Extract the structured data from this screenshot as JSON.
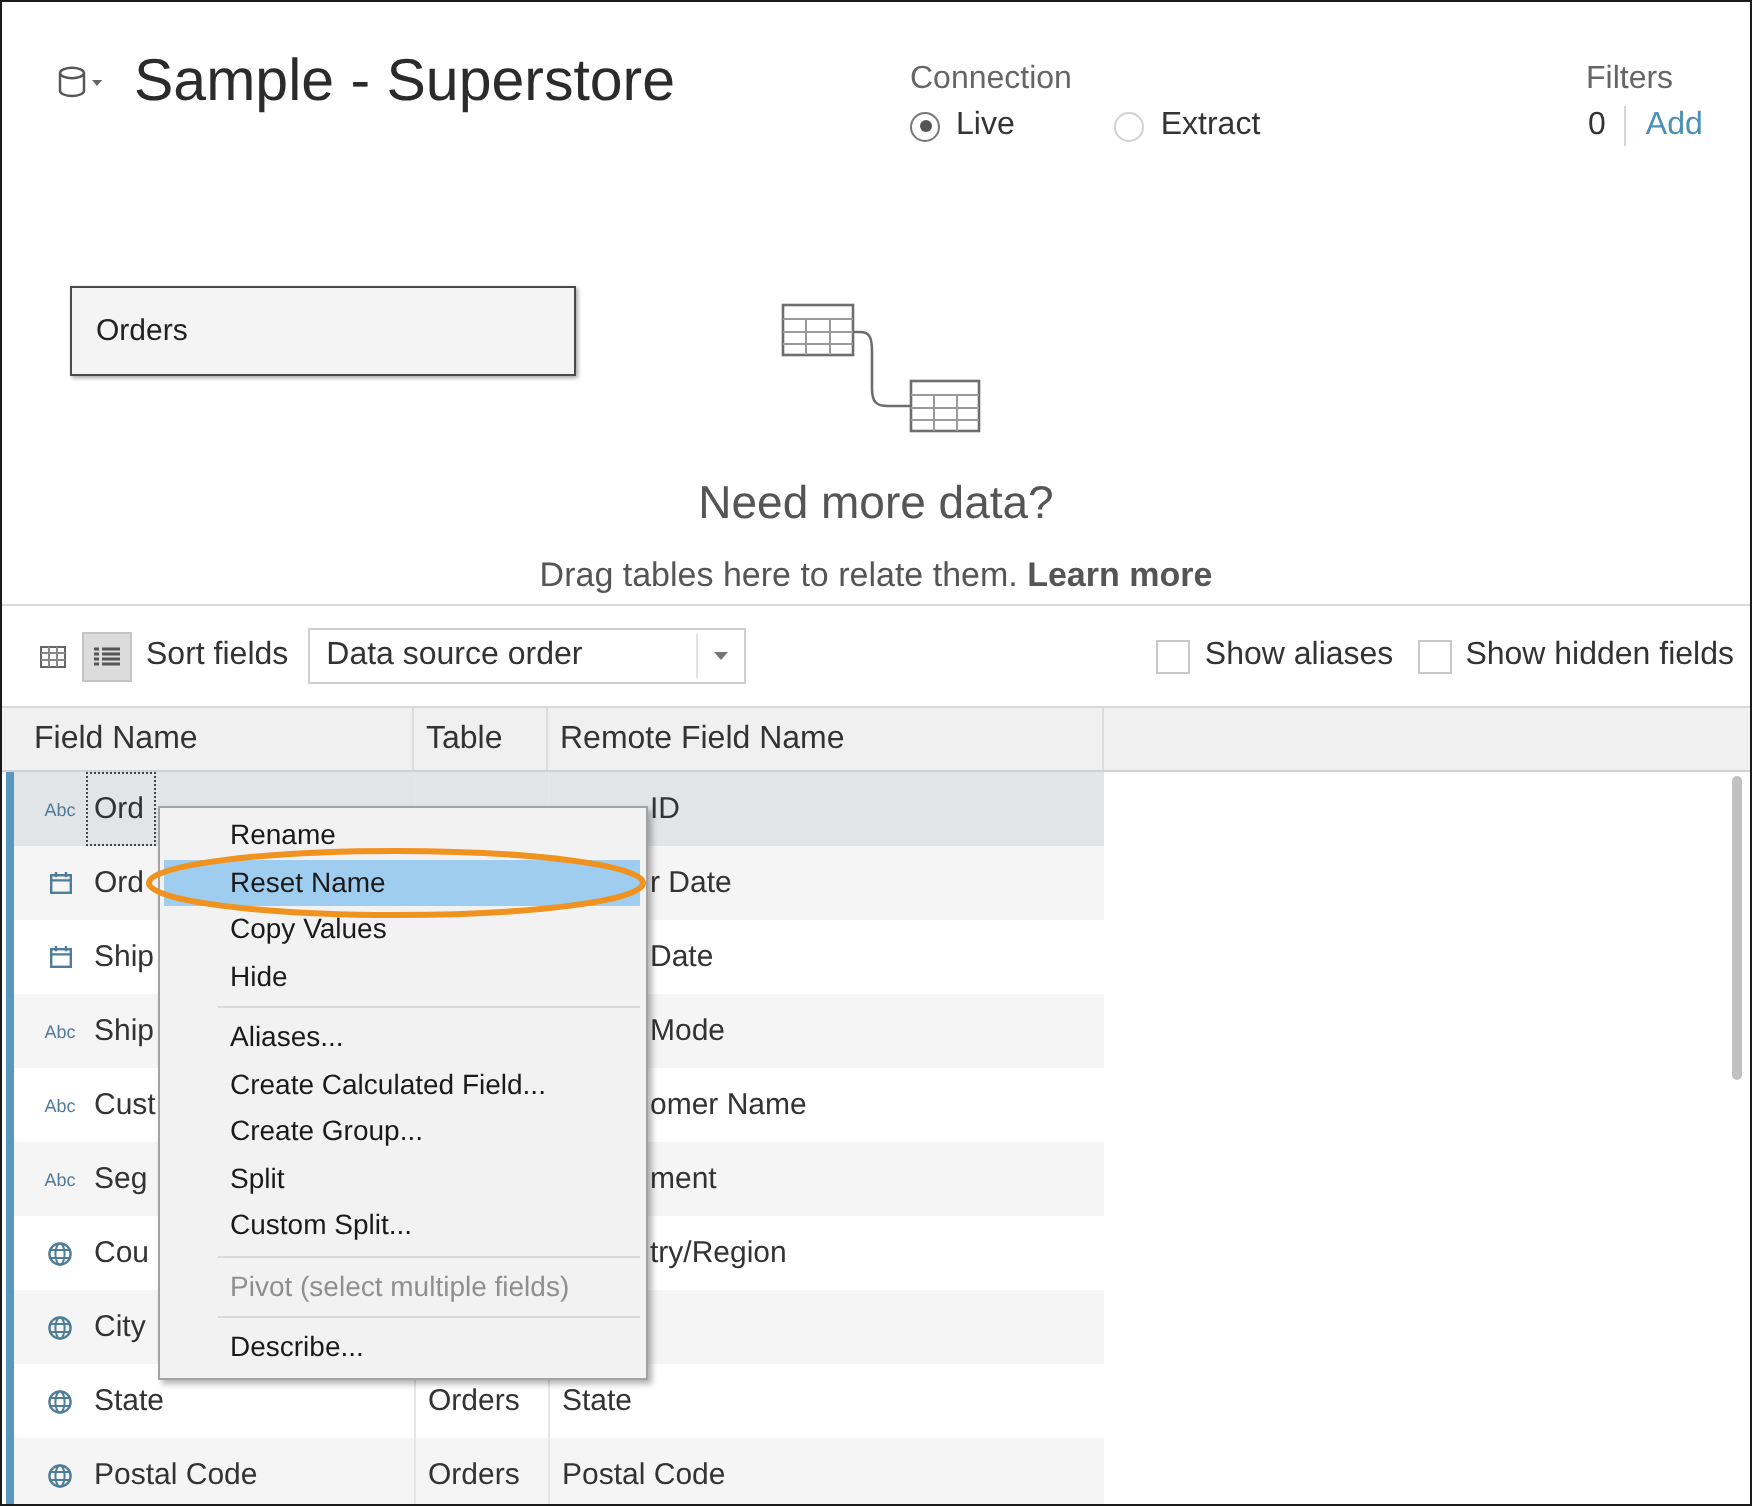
{
  "datasource": {
    "title": "Sample - Superstore"
  },
  "connection": {
    "label": "Connection",
    "options": [
      {
        "label": "Live",
        "selected": true
      },
      {
        "label": "Extract",
        "selected": false
      }
    ]
  },
  "filters": {
    "label": "Filters",
    "count": "0",
    "add_link": "Add"
  },
  "canvas": {
    "tables": [
      {
        "name": "Orders"
      }
    ],
    "empty_title": "Need more data?",
    "hint": "Drag tables here to relate them.",
    "hint_link": "Learn more"
  },
  "toolbar": {
    "view_toggles": [
      {
        "kind": "grid",
        "selected": false
      },
      {
        "kind": "list",
        "selected": true
      }
    ],
    "sort_label": "Sort fields",
    "sort_value": "Data source order",
    "checkboxes": [
      {
        "label": "Show aliases",
        "checked": false
      },
      {
        "label": "Show hidden fields",
        "checked": false
      }
    ]
  },
  "table": {
    "columns": [
      "Field Name",
      "Table",
      "Remote Field Name"
    ],
    "rows": [
      {
        "kind": "text",
        "type_label": "Abc",
        "field_name": "Ord",
        "remote_field_name": "ID",
        "selected": true
      },
      {
        "kind": "date",
        "field_name": "Ord",
        "remote_field_name": "r Date",
        "selected": false
      },
      {
        "kind": "date",
        "field_name": "Ship",
        "remote_field_name": "Date",
        "selected": false
      },
      {
        "kind": "text",
        "type_label": "Abc",
        "field_name": "Ship",
        "remote_field_name": "Mode",
        "selected": false
      },
      {
        "kind": "text",
        "type_label": "Abc",
        "field_name": "Cust",
        "remote_field_name": "omer Name",
        "selected": false
      },
      {
        "kind": "text",
        "type_label": "Abc",
        "field_name": "Seg",
        "remote_field_name": "ment",
        "selected": false
      },
      {
        "kind": "geo",
        "field_name": "Cou",
        "remote_field_name": "try/Region",
        "selected": false
      },
      {
        "kind": "geo",
        "field_name": "City",
        "selected": false
      },
      {
        "kind": "geo",
        "field_name": "State",
        "table": "Orders",
        "remote_field_name": "State",
        "selected": false
      },
      {
        "kind": "geo",
        "field_name": "Postal Code",
        "table": "Orders",
        "remote_field_name": "Postal Code",
        "selected": false
      }
    ]
  },
  "context_menu": {
    "groups": [
      [
        {
          "label": "Rename",
          "selected": false,
          "disabled": false,
          "circled": false
        },
        {
          "label": "Reset Name",
          "selected": true,
          "disabled": false,
          "circled": true
        },
        {
          "label": "Copy Values",
          "selected": false,
          "disabled": false,
          "circled": false
        },
        {
          "label": "Hide",
          "selected": false,
          "disabled": false,
          "circled": false
        }
      ],
      [
        {
          "label": "Aliases...",
          "selected": false,
          "disabled": false,
          "circled": false
        },
        {
          "label": "Create Calculated Field...",
          "selected": false,
          "disabled": false,
          "circled": false
        },
        {
          "label": "Create Group...",
          "selected": false,
          "disabled": false,
          "circled": false
        },
        {
          "label": "Split",
          "selected": false,
          "disabled": false,
          "circled": false
        },
        {
          "label": "Custom Split...",
          "selected": false,
          "disabled": false,
          "circled": false
        }
      ],
      [
        {
          "label": "Pivot (select multiple fields)",
          "selected": false,
          "disabled": true,
          "circled": false
        }
      ],
      [
        {
          "label": "Describe...",
          "selected": false,
          "disabled": false,
          "circled": false
        }
      ]
    ]
  }
}
